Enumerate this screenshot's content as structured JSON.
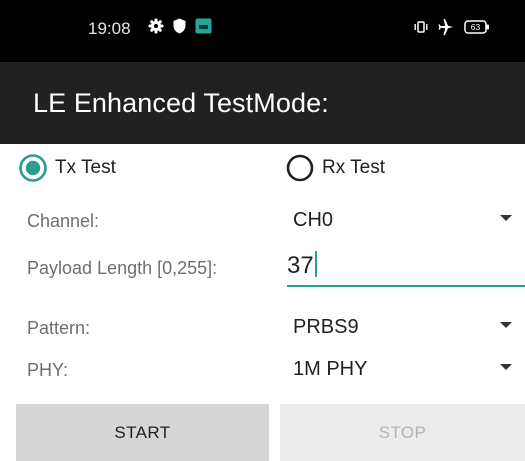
{
  "status_bar": {
    "time": "19:08",
    "left_icons": [
      "gear-icon",
      "shield-icon",
      "app-notification-icon"
    ],
    "right_icons": [
      "vibrate-icon",
      "airplane-mode-icon",
      "battery-icon"
    ],
    "battery_level": "63"
  },
  "app_bar": {
    "title": "LE Enhanced TestMode:"
  },
  "mode": {
    "options": [
      {
        "label": "Tx Test",
        "selected": true
      },
      {
        "label": "Rx Test",
        "selected": false
      }
    ]
  },
  "form": {
    "channel": {
      "label": "Channel:",
      "value": "CH0"
    },
    "payload_length": {
      "label": "Payload Length [0,255]:",
      "value": "37"
    },
    "pattern": {
      "label": "Pattern:",
      "value": "PRBS9"
    },
    "phy": {
      "label": "PHY:",
      "value": "1M PHY"
    }
  },
  "buttons": {
    "start": "START",
    "stop": "STOP"
  },
  "colors": {
    "accent": "#2a9d8f",
    "app_bar": "#212121",
    "status_bar": "#000000"
  }
}
